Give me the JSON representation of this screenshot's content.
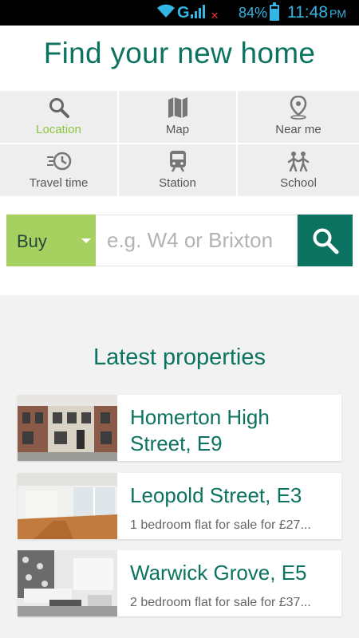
{
  "status_bar": {
    "carrier": "G",
    "sim_badge": "2",
    "battery": "84%",
    "time": "11:48",
    "ampm": "PM"
  },
  "header": {
    "title": "Find your new home"
  },
  "search_modes": [
    {
      "label": "Location",
      "icon": "search-icon",
      "active": true
    },
    {
      "label": "Map",
      "icon": "map-icon"
    },
    {
      "label": "Near me",
      "icon": "location-pin-icon"
    },
    {
      "label": "Travel time",
      "icon": "clock-icon"
    },
    {
      "label": "Station",
      "icon": "train-icon"
    },
    {
      "label": "School",
      "icon": "children-icon"
    }
  ],
  "search": {
    "type_value": "Buy",
    "placeholder": "e.g. W4 or Brixton"
  },
  "latest": {
    "title": "Latest properties",
    "properties": [
      {
        "title": "Homerton High Street, E9",
        "description": ""
      },
      {
        "title": "Leopold Street, E3",
        "description": "1 bedroom flat for sale for £27..."
      },
      {
        "title": "Warwick Grove, E5",
        "description": "2 bedroom flat for sale for £37..."
      }
    ]
  },
  "colors": {
    "brand_green": "#0b735f",
    "accent_green": "#a6d05f",
    "status_blue": "#33b5e5"
  }
}
